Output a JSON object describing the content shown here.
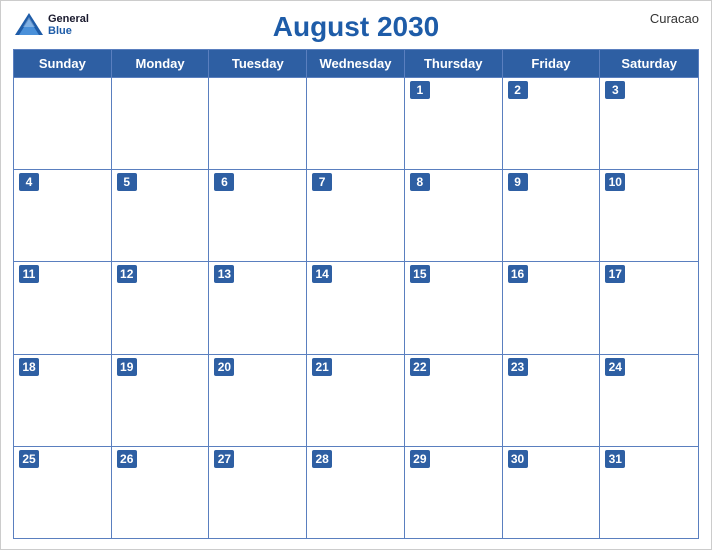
{
  "header": {
    "title": "August 2030",
    "region": "Curacao",
    "logo": {
      "general": "General",
      "blue": "Blue"
    }
  },
  "dayHeaders": [
    "Sunday",
    "Monday",
    "Tuesday",
    "Wednesday",
    "Thursday",
    "Friday",
    "Saturday"
  ],
  "weeks": [
    [
      {
        "day": "",
        "empty": true
      },
      {
        "day": "",
        "empty": true
      },
      {
        "day": "",
        "empty": true
      },
      {
        "day": "",
        "empty": true
      },
      {
        "day": "1",
        "empty": false
      },
      {
        "day": "2",
        "empty": false
      },
      {
        "day": "3",
        "empty": false
      }
    ],
    [
      {
        "day": "4",
        "empty": false
      },
      {
        "day": "5",
        "empty": false
      },
      {
        "day": "6",
        "empty": false
      },
      {
        "day": "7",
        "empty": false
      },
      {
        "day": "8",
        "empty": false
      },
      {
        "day": "9",
        "empty": false
      },
      {
        "day": "10",
        "empty": false
      }
    ],
    [
      {
        "day": "11",
        "empty": false
      },
      {
        "day": "12",
        "empty": false
      },
      {
        "day": "13",
        "empty": false
      },
      {
        "day": "14",
        "empty": false
      },
      {
        "day": "15",
        "empty": false
      },
      {
        "day": "16",
        "empty": false
      },
      {
        "day": "17",
        "empty": false
      }
    ],
    [
      {
        "day": "18",
        "empty": false
      },
      {
        "day": "19",
        "empty": false
      },
      {
        "day": "20",
        "empty": false
      },
      {
        "day": "21",
        "empty": false
      },
      {
        "day": "22",
        "empty": false
      },
      {
        "day": "23",
        "empty": false
      },
      {
        "day": "24",
        "empty": false
      }
    ],
    [
      {
        "day": "25",
        "empty": false
      },
      {
        "day": "26",
        "empty": false
      },
      {
        "day": "27",
        "empty": false
      },
      {
        "day": "28",
        "empty": false
      },
      {
        "day": "29",
        "empty": false
      },
      {
        "day": "30",
        "empty": false
      },
      {
        "day": "31",
        "empty": false
      }
    ]
  ]
}
